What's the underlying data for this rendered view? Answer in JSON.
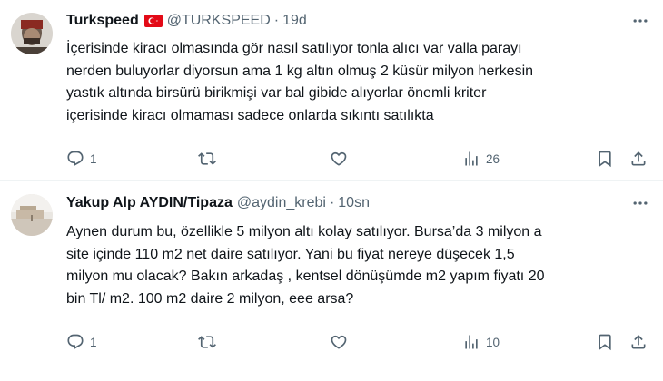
{
  "tweets": [
    {
      "display_name": "Turkspeed",
      "handle": "@TURKSPEED",
      "separator": "·",
      "time": "19d",
      "text": "İçerisinde kiracı olmasında gör nasıl satılıyor tonla alıcı var valla parayı\nnerden buluyorlar diyorsun ama 1 kg altın olmuş 2 küsür milyon herkesin\nyastık altında birsürü birikmişi var bal gibide alıyorlar önemli kriter\niçerisinde kiracı olmaması sadece onlarda sıkıntı satılıkta",
      "reply_count": "1",
      "retweet_count": "",
      "like_count": "",
      "view_count": "26"
    },
    {
      "display_name": "Yakup Alp AYDIN/Tipaza",
      "handle": "@aydin_krebi",
      "separator": "·",
      "time": "10sn",
      "text": "Aynen durum bu, özellikle 5 milyon altı kolay satılıyor. Bursa’da 3 milyon a\nsite içinde 110 m2 net daire satılıyor. Yani bu fiyat nereye düşecek 1,5\nmilyon mu olacak? Bakın arkadaş , kentsel dönüşümde m2 yapım fiyatı 20\nbin Tl/ m2. 100 m2 daire 2 milyon, eee arsa?",
      "reply_count": "1",
      "retweet_count": "",
      "like_count": "",
      "view_count": "10"
    }
  ],
  "icons": {
    "flag": "turkey-flag-icon",
    "more": "more-options-icon",
    "reply": "reply-icon",
    "retweet": "retweet-icon",
    "like": "like-icon",
    "views": "views-icon",
    "bookmark": "bookmark-icon",
    "share": "share-icon"
  },
  "colors": {
    "text": "#0f1419",
    "secondary": "#536471",
    "divider": "#eff3f4",
    "flag_red": "#e30a17"
  }
}
